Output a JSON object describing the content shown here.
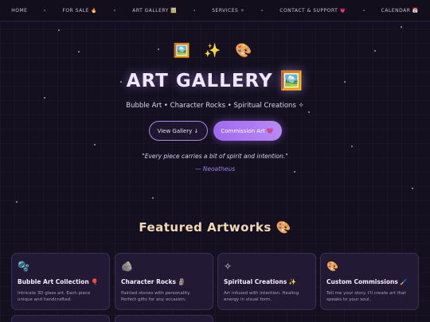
{
  "nav": {
    "items": [
      {
        "label": "HOME"
      },
      {
        "label": "FOR SALE 🔥"
      },
      {
        "label": "ART GALLERY 🖼️"
      },
      {
        "label": "SERVICES ✧"
      },
      {
        "label": "CONTACT & SUPPORT 💗"
      },
      {
        "label": "CALENDAR 📅"
      }
    ]
  },
  "hero": {
    "icons": "🖼️ ✨ 🎨",
    "title": "ART GALLERY 🖼️",
    "subtitle": "Bubble Art • Character Rocks • Spiritual Creations ✧",
    "view_button": "View Gallery ↓",
    "commission_button": "Commission Art 💗",
    "quote": "\"Every piece carries a bit of spirit and intention.\"",
    "author": "— Neoatheus"
  },
  "featured": {
    "heading": "Featured Artworks 🎨",
    "cards": [
      {
        "icon": "🫧",
        "icon_name": "bubble-icon",
        "title": "Bubble Art Collection 🎈",
        "desc": "Intricate 3D glass art. Each piece unique and handcrafted."
      },
      {
        "icon": "🪨",
        "icon_name": "rock-icon",
        "title": "Character Rocks 🗿",
        "desc": "Painted stones with personality. Perfect gifts for any occasion."
      },
      {
        "icon": "✧",
        "icon_name": "sparkle-icon",
        "title": "Spiritual Creations ✨",
        "desc": "Art infused with intention. Healing energy in visual form."
      },
      {
        "icon": "🎨",
        "icon_name": "palette-icon",
        "title": "Custom Commissions 🖌️",
        "desc": "Tell me your story. I'll create art that speaks to your soul."
      }
    ]
  },
  "colors": {
    "background": "#14101f",
    "accent": "#9d6af0",
    "heading_gold": "#f2d9b3",
    "card_bg": "#221a35"
  }
}
